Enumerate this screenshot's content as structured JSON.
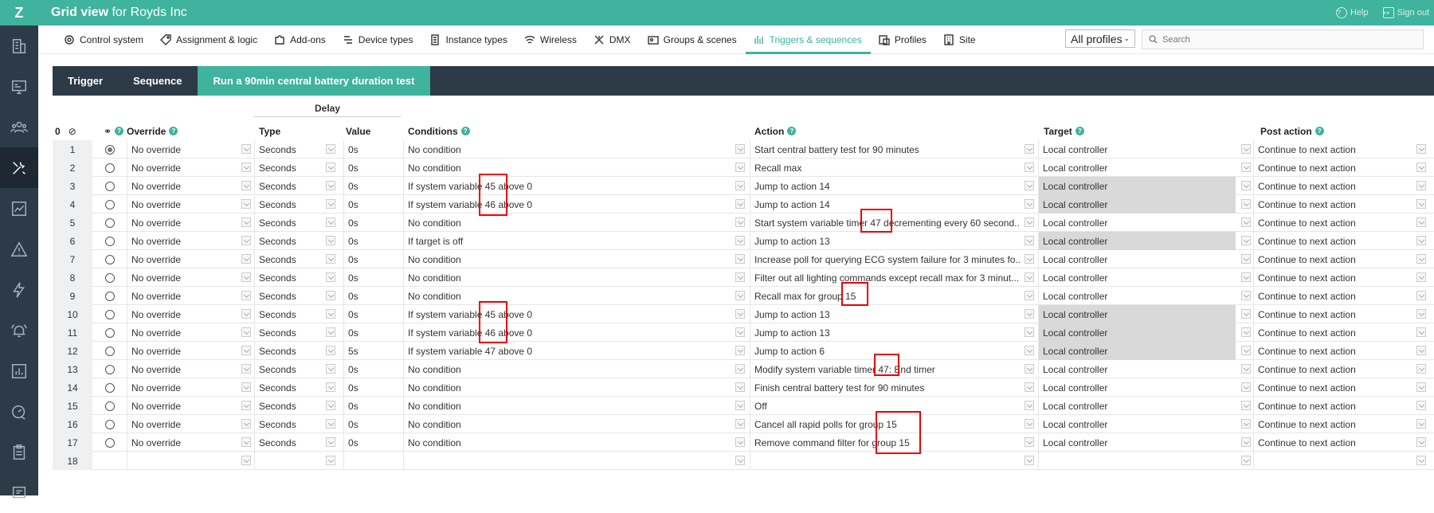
{
  "app": {
    "logo": "Z",
    "title_bold": "Grid view",
    "title_rest": " for Royds Inc",
    "help": "Help",
    "sign_out": "Sign out"
  },
  "sidebar": {
    "items": [
      "building-icon",
      "dashboard-icon",
      "users-icon",
      "tools-icon",
      "reports-icon",
      "warning-icon",
      "lightning-icon",
      "alarm-icon",
      "chart-icon",
      "speed-icon",
      "clipboard-icon",
      "certificate-icon"
    ],
    "active_index": 3
  },
  "nav": {
    "items": [
      "Control system",
      "Assignment & logic",
      "Add-ons",
      "Device types",
      "Instance types",
      "Wireless",
      "DMX",
      "Groups & scenes",
      "Triggers & sequences",
      "Profiles",
      "Site"
    ],
    "active_index": 8,
    "profiles_select": "All profiles",
    "search_placeholder": "Search"
  },
  "tabs": {
    "trigger": "Trigger",
    "sequence": "Sequence",
    "active": "Run a 90min central battery duration test"
  },
  "headers": {
    "count": "0",
    "delay": "Delay",
    "override": "Override",
    "type": "Type",
    "value": "Value",
    "conditions": "Conditions",
    "action": "Action",
    "target": "Target",
    "post_action": "Post action"
  },
  "rows": [
    {
      "n": "1",
      "sel": true,
      "ov": "No override",
      "ty": "Seconds",
      "va": "0s",
      "co": "No condition",
      "ac": "Start central battery test for 90 minutes",
      "ta": "Local controller",
      "tg": false,
      "pa": "Continue to next action"
    },
    {
      "n": "2",
      "sel": false,
      "ov": "No override",
      "ty": "Seconds",
      "va": "0s",
      "co": "No condition",
      "ac": "Recall max",
      "ta": "Local controller",
      "tg": false,
      "pa": "Continue to next action"
    },
    {
      "n": "3",
      "sel": false,
      "ov": "No override",
      "ty": "Seconds",
      "va": "0s",
      "co": "If system variable 45 above 0",
      "ac": "Jump to action 14",
      "ta": "Local controller",
      "tg": true,
      "pa": "Continue to next action"
    },
    {
      "n": "4",
      "sel": false,
      "ov": "No override",
      "ty": "Seconds",
      "va": "0s",
      "co": "If system variable 46 above 0",
      "ac": "Jump to action 14",
      "ta": "Local controller",
      "tg": true,
      "pa": "Continue to next action"
    },
    {
      "n": "5",
      "sel": false,
      "ov": "No override",
      "ty": "Seconds",
      "va": "0s",
      "co": "No condition",
      "ac": "Start system variable timer 47 decrementing every 60 second...",
      "ta": "Local controller",
      "tg": false,
      "pa": "Continue to next action"
    },
    {
      "n": "6",
      "sel": false,
      "ov": "No override",
      "ty": "Seconds",
      "va": "0s",
      "co": "If target is off",
      "ac": "Jump to action 13",
      "ta": "Local controller",
      "tg": true,
      "pa": "Continue to next action"
    },
    {
      "n": "7",
      "sel": false,
      "ov": "No override",
      "ty": "Seconds",
      "va": "0s",
      "co": "No condition",
      "ac": "Increase poll for querying ECG system failure for 3 minutes fo...",
      "ta": "Local controller",
      "tg": false,
      "pa": "Continue to next action"
    },
    {
      "n": "8",
      "sel": false,
      "ov": "No override",
      "ty": "Seconds",
      "va": "0s",
      "co": "No condition",
      "ac": "Filter out all lighting commands except recall max for 3 minut...",
      "ta": "Local controller",
      "tg": false,
      "pa": "Continue to next action"
    },
    {
      "n": "9",
      "sel": false,
      "ov": "No override",
      "ty": "Seconds",
      "va": "0s",
      "co": "No condition",
      "ac": "Recall max for group 15",
      "ta": "Local controller",
      "tg": false,
      "pa": "Continue to next action"
    },
    {
      "n": "10",
      "sel": false,
      "ov": "No override",
      "ty": "Seconds",
      "va": "0s",
      "co": "If system variable 45 above 0",
      "ac": "Jump to action 13",
      "ta": "Local controller",
      "tg": true,
      "pa": "Continue to next action"
    },
    {
      "n": "11",
      "sel": false,
      "ov": "No override",
      "ty": "Seconds",
      "va": "0s",
      "co": "If system variable 46 above 0",
      "ac": "Jump to action 13",
      "ta": "Local controller",
      "tg": true,
      "pa": "Continue to next action"
    },
    {
      "n": "12",
      "sel": false,
      "ov": "No override",
      "ty": "Seconds",
      "va": "5s",
      "co": "If system variable 47 above 0",
      "ac": "Jump to action 6",
      "ta": "Local controller",
      "tg": true,
      "pa": "Continue to next action"
    },
    {
      "n": "13",
      "sel": false,
      "ov": "No override",
      "ty": "Seconds",
      "va": "0s",
      "co": "No condition",
      "ac": "Modify system variable timer 47: End timer",
      "ta": "Local controller",
      "tg": false,
      "pa": "Continue to next action"
    },
    {
      "n": "14",
      "sel": false,
      "ov": "No override",
      "ty": "Seconds",
      "va": "0s",
      "co": "No condition",
      "ac": "Finish central battery test for 90 minutes",
      "ta": "Local controller",
      "tg": false,
      "pa": "Continue to next action"
    },
    {
      "n": "15",
      "sel": false,
      "ov": "No override",
      "ty": "Seconds",
      "va": "0s",
      "co": "No condition",
      "ac": "Off",
      "ta": "Local controller",
      "tg": false,
      "pa": "Continue to next action"
    },
    {
      "n": "16",
      "sel": false,
      "ov": "No override",
      "ty": "Seconds",
      "va": "0s",
      "co": "No condition",
      "ac": "Cancel all rapid polls for group 15",
      "ta": "Local controller",
      "tg": false,
      "pa": "Continue to next action"
    },
    {
      "n": "17",
      "sel": false,
      "ov": "No override",
      "ty": "Seconds",
      "va": "0s",
      "co": "No condition",
      "ac": "Remove command filter for group 15",
      "ta": "Local controller",
      "tg": false,
      "pa": "Continue to next action"
    },
    {
      "n": "18",
      "sel": null,
      "ov": "",
      "ty": "",
      "va": "",
      "co": "",
      "ac": "",
      "ta": "",
      "tg": false,
      "pa": ""
    }
  ],
  "colors": {
    "accent": "#3fb39d",
    "dark": "#2d3a48",
    "highlight_box": "#e00000"
  }
}
